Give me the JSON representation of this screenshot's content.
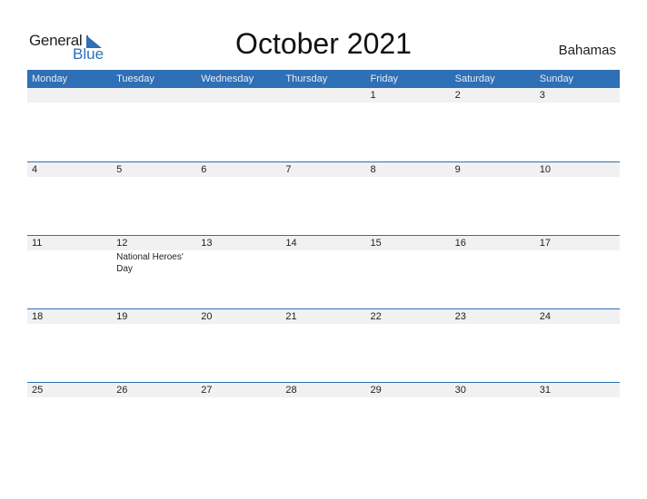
{
  "logo": {
    "word1": "General",
    "word2": "Blue"
  },
  "title": "October 2021",
  "country": "Bahamas",
  "colors": {
    "accent": "#2e6fb5",
    "row_bg": "#f1f1f1"
  },
  "weekdays": [
    "Monday",
    "Tuesday",
    "Wednesday",
    "Thursday",
    "Friday",
    "Saturday",
    "Sunday"
  ],
  "weeks": [
    {
      "days": [
        "",
        "",
        "",
        "",
        "1",
        "2",
        "3"
      ],
      "events": [
        "",
        "",
        "",
        "",
        "",
        "",
        ""
      ]
    },
    {
      "days": [
        "4",
        "5",
        "6",
        "7",
        "8",
        "9",
        "10"
      ],
      "events": [
        "",
        "",
        "",
        "",
        "",
        "",
        ""
      ]
    },
    {
      "days": [
        "11",
        "12",
        "13",
        "14",
        "15",
        "16",
        "17"
      ],
      "events": [
        "",
        "National Heroes' Day",
        "",
        "",
        "",
        "",
        ""
      ]
    },
    {
      "days": [
        "18",
        "19",
        "20",
        "21",
        "22",
        "23",
        "24"
      ],
      "events": [
        "",
        "",
        "",
        "",
        "",
        "",
        ""
      ]
    },
    {
      "days": [
        "25",
        "26",
        "27",
        "28",
        "29",
        "30",
        "31"
      ],
      "events": [
        "",
        "",
        "",
        "",
        "",
        "",
        ""
      ]
    }
  ]
}
